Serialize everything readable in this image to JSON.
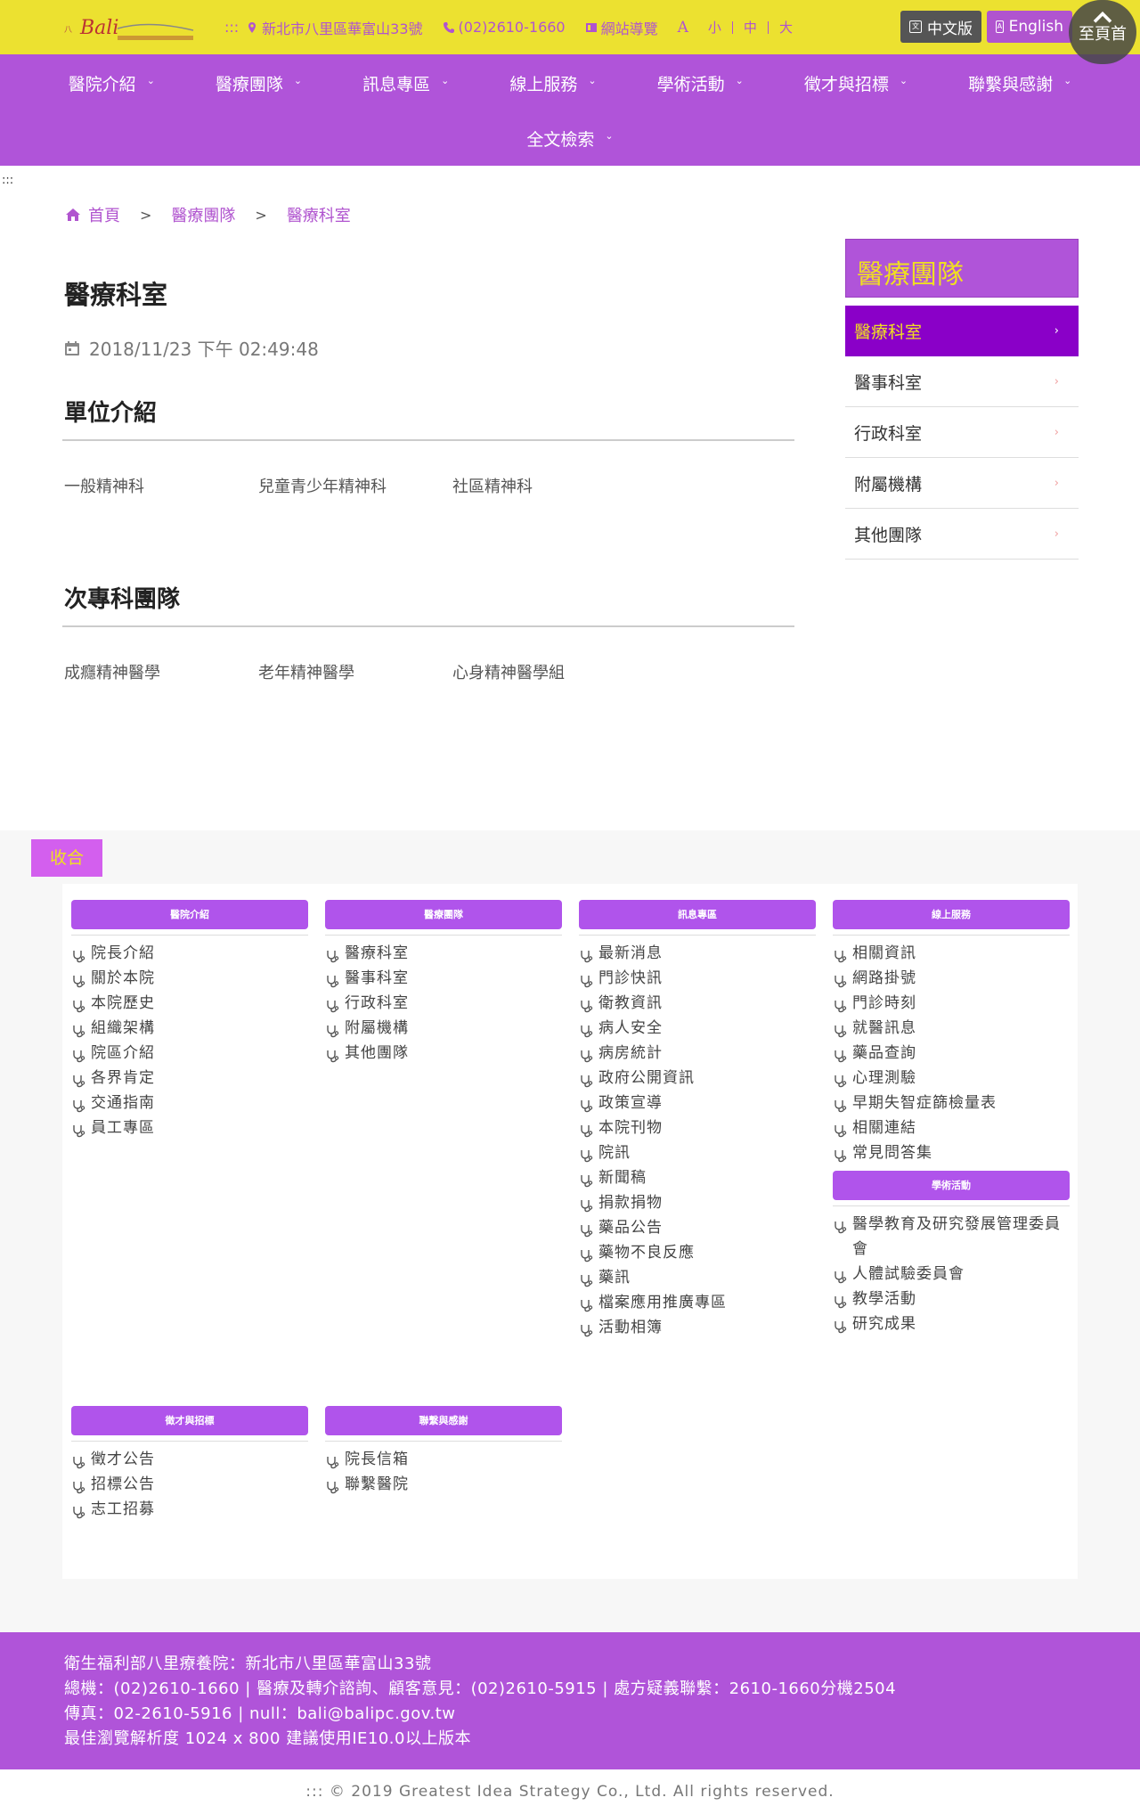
{
  "header": {
    "address": "新北市八里區華富山33號",
    "phone": "(02)2610-1660",
    "sitemap": "網站導覽",
    "font_size": {
      "symbol": "A",
      "options": [
        "小",
        "中",
        "大"
      ]
    },
    "lang_zh": "中文版",
    "lang_en": "English",
    "to_top": "至頁首",
    "skip_mark": ":::"
  },
  "nav": {
    "items": [
      "醫院介紹",
      "醫療團隊",
      "訊息專區",
      "線上服務",
      "學術活動",
      "徵才與招標",
      "聯繫與感謝",
      "全文檢索"
    ]
  },
  "breadcrumb": [
    "首頁",
    "醫療團隊",
    "醫療科室"
  ],
  "page": {
    "title": "醫療科室",
    "date": "2018/11/23 下午 02:49:48",
    "sections": [
      {
        "heading": "單位介紹",
        "items": [
          "一般精神科",
          "兒童青少年精神科",
          "社區精神科"
        ]
      },
      {
        "heading": "次專科團隊",
        "items": [
          "成癮精神醫學",
          "老年精神醫學",
          "心身精神醫學組"
        ]
      }
    ]
  },
  "sidebar": {
    "title": "醫療團隊",
    "items": [
      "醫療科室",
      "醫事科室",
      "行政科室",
      "附屬機構",
      "其他團隊"
    ],
    "active_index": 0
  },
  "sitemap": {
    "collapse_label": "收合",
    "columns": [
      {
        "title": "醫院介紹",
        "items": [
          "院長介紹",
          "關於本院",
          "本院歷史",
          "組織架構",
          "院區介紹",
          "各界肯定",
          "交通指南",
          "員工專區"
        ]
      },
      {
        "title": "醫療團隊",
        "items": [
          "醫療科室",
          "醫事科室",
          "行政科室",
          "附屬機構",
          "其他團隊"
        ]
      },
      {
        "title": "訊息專區",
        "items": [
          "最新消息",
          "門診快訊",
          "衛教資訊",
          "病人安全",
          "病房統計",
          "政府公開資訊",
          "政策宣導",
          "本院刊物",
          "院訊",
          "新聞稿",
          "捐款捐物",
          "藥品公告",
          "藥物不良反應",
          "藥訊",
          "檔案應用推廣專區",
          "活動相簿"
        ]
      },
      {
        "title": "線上服務",
        "items": [
          "相關資訊",
          "網路掛號",
          "門診時刻",
          "就醫訊息",
          "藥品查詢",
          "心理測驗",
          "早期失智症篩檢量表",
          "相關連結",
          "常見問答集"
        ]
      },
      {
        "title": "學術活動",
        "items": [
          "醫學教育及研究發展管理委員會",
          "人體試驗委員會",
          "教學活動",
          "研究成果"
        ]
      },
      {
        "title": "徵才與招標",
        "items": [
          "徵才公告",
          "招標公告",
          "志工招募"
        ]
      },
      {
        "title": "聯繫與感謝",
        "items": [
          "院長信箱",
          "聯繫醫院"
        ]
      }
    ]
  },
  "footer": {
    "lines": [
      "衛生福利部八里療養院：新北市八里區華富山33號",
      "總機：(02)2610-1660 | 醫療及轉介諮詢、顧客意見：(02)2610-5915 | 處方疑義聯繫：2610-1660分機2504",
      "傳真：02-2610-5916 | null：bali@balipc.gov.tw",
      "最佳瀏覽解析度 1024 x 800 建議使用IE10.0以上版本"
    ],
    "copyright": "::: © 2019 Greatest Idea Strategy Co., Ltd. All rights reserved."
  },
  "colors": {
    "top_bar": "#ece130",
    "primary_purple": "#b054d9",
    "sidebar_active": "#8a00c8",
    "accent_yellow": "#f0e020"
  },
  "icons": [
    "logo",
    "location-pin-icon",
    "phone-icon",
    "sitemap-icon",
    "translate-icon",
    "chevron-up-icon",
    "chevron-down-icon",
    "home-icon",
    "calendar-icon",
    "chevron-right-icon",
    "stethoscope-icon"
  ]
}
